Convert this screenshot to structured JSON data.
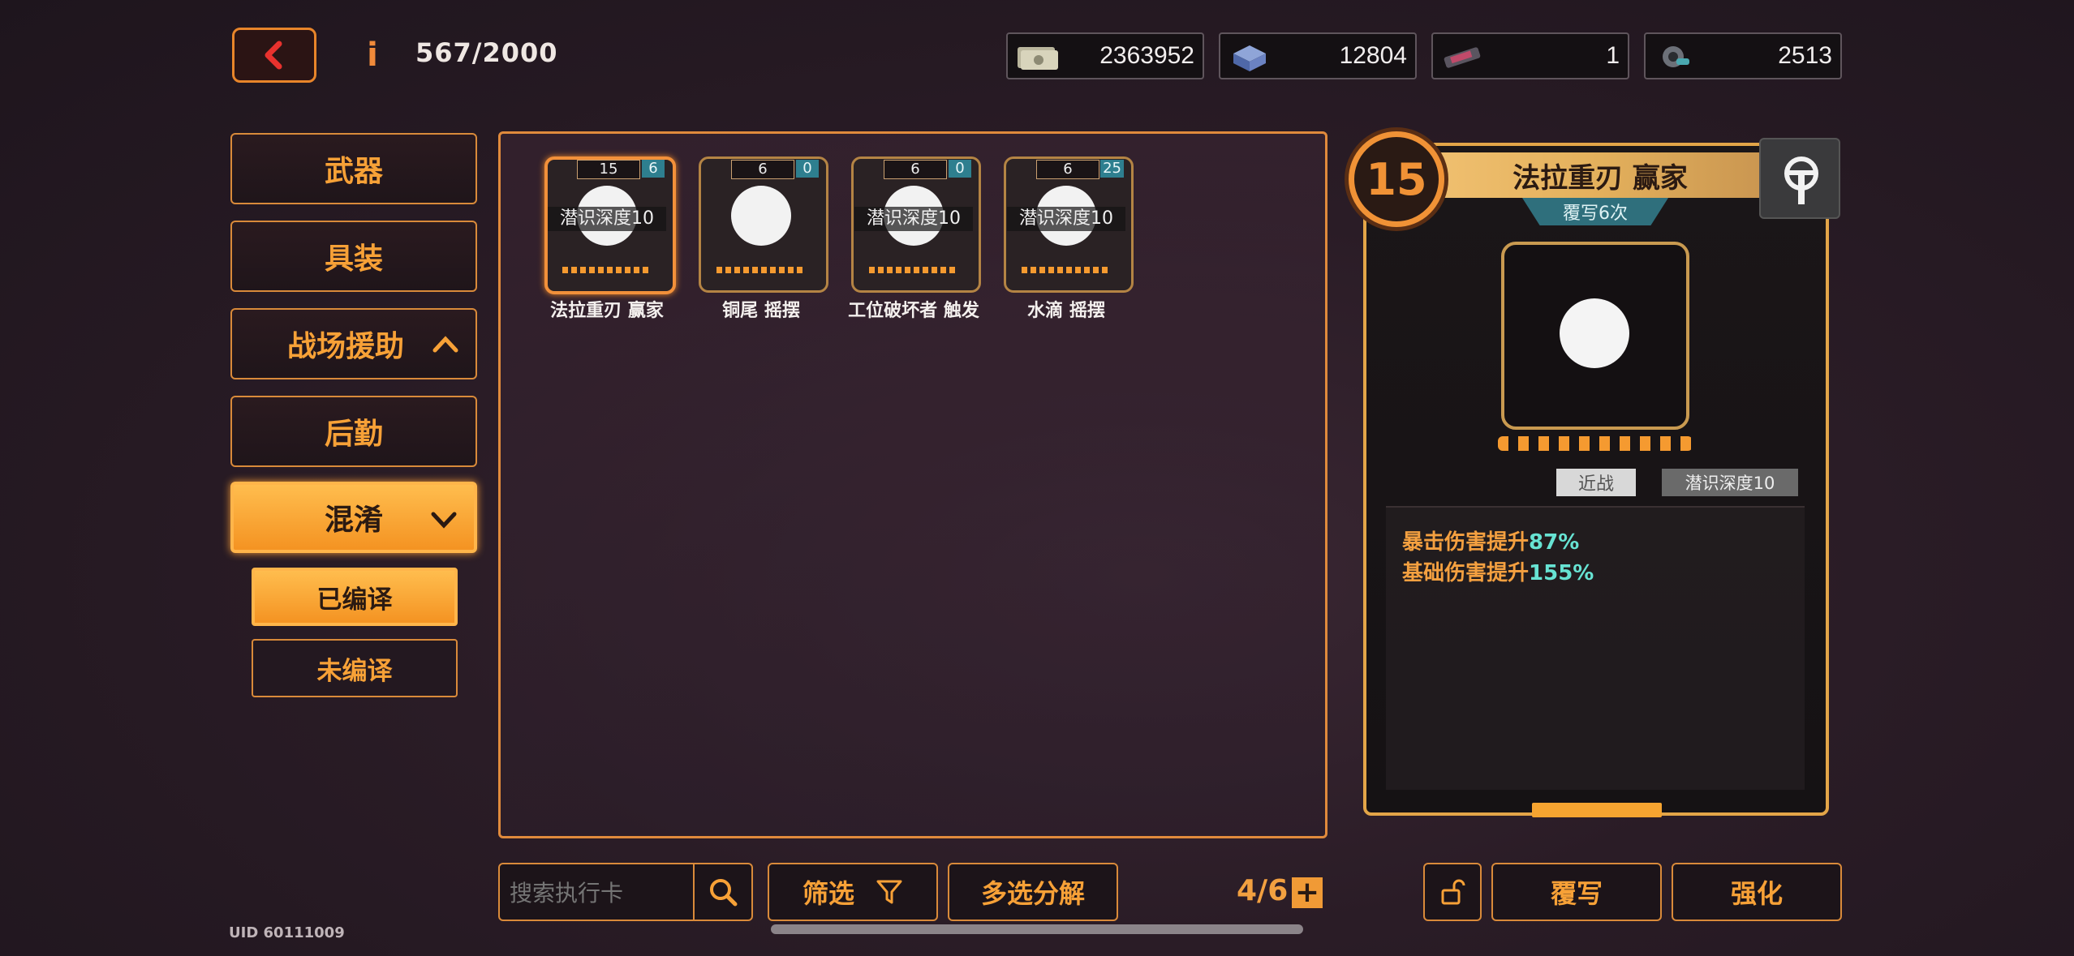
{
  "top": {
    "info_icon": "i",
    "capacity": "567/2000",
    "resources": [
      {
        "icon": "cash-icon",
        "value": "2363952"
      },
      {
        "icon": "chip-box-icon",
        "value": "12804"
      },
      {
        "icon": "circuit-board-icon",
        "value": "1"
      },
      {
        "icon": "gear-part-icon",
        "value": "2513"
      }
    ]
  },
  "menu": {
    "weapons": "武器",
    "gear": "具装",
    "battlefield_support": "战场援助",
    "logistics": "后勤",
    "confusion": "混淆",
    "compiled": "已编译",
    "uncompiled": "未编译"
  },
  "cards": [
    {
      "level": "15",
      "badge": "6",
      "lock": "潜识深度10",
      "name": "法拉重刃 赢家",
      "selected": true
    },
    {
      "level": "6",
      "badge": "0",
      "lock": "",
      "name": "铜尾 摇摆",
      "selected": false
    },
    {
      "level": "6",
      "badge": "0",
      "lock": "潜识深度10",
      "name": "工位破坏者 触发",
      "selected": false
    },
    {
      "level": "6",
      "badge": "25",
      "lock": "潜识深度10",
      "name": "水滴 摇摆",
      "selected": false
    }
  ],
  "detail": {
    "level": "15",
    "title": "法拉重刃 赢家",
    "rewrite_count": "覆写6次",
    "tag_type": "近战",
    "tag_lock": "潜识深度10",
    "stats": [
      {
        "label": "暴击伤害提升",
        "value": "87%"
      },
      {
        "label": "基础伤害提升",
        "value": "155%"
      }
    ]
  },
  "bottom": {
    "search_placeholder": "搜索执行卡",
    "filter": "筛选",
    "multi_decompose": "多选分解",
    "page": "4/6",
    "plus": "+",
    "rewrite": "覆写",
    "enhance": "强化"
  },
  "uid": "UID 60111009",
  "colors": {
    "accent": "#f7a137",
    "teal": "#2e7f8f",
    "bg": "#2a1c26"
  }
}
